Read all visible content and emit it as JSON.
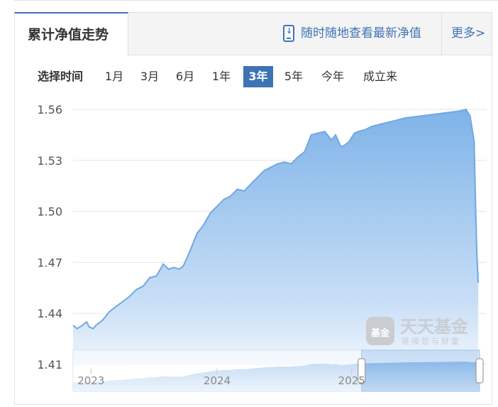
{
  "header": {
    "title": "累计净值走势",
    "promo_text": "随时随地查看最新净值",
    "more_label": "更多>"
  },
  "range_selector": {
    "label": "选择时间",
    "options": [
      "1月",
      "3月",
      "6月",
      "1年",
      "3年",
      "5年",
      "今年",
      "成立来"
    ],
    "active": "3年"
  },
  "watermark": {
    "name": "天天基金",
    "slogan": "链接您与财富",
    "badge": "基金"
  },
  "colors": {
    "accent": "#3e73b4",
    "line": "#6fa8e3",
    "fill": "#8ab9ea"
  },
  "chart_data": {
    "type": "area",
    "title": "",
    "xlabel": "",
    "ylabel": "",
    "ylim": [
      1.41,
      1.56
    ],
    "yticks": [
      "1.41",
      "1.44",
      "1.47",
      "1.50",
      "1.53",
      "1.56"
    ],
    "xticks": [
      {
        "x": 2023.0,
        "label": "2023"
      },
      {
        "x": 2024.0,
        "label": "2024"
      },
      {
        "x": 2025.0,
        "label": "2025"
      }
    ],
    "xlim": [
      2022.93,
      2025.95
    ],
    "grid": true,
    "series": [
      {
        "x": [
          2022.93,
          2022.96,
          2023.0,
          2023.03,
          2023.05,
          2023.08,
          2023.1,
          2023.15,
          2023.2,
          2023.25,
          2023.3,
          2023.35,
          2023.4,
          2023.45,
          2023.5,
          2023.55,
          2023.6,
          2023.64,
          2023.68,
          2023.72,
          2023.75,
          2023.8,
          2023.85,
          2023.9,
          2023.95,
          2024.0,
          2024.05,
          2024.1,
          2024.15,
          2024.2,
          2024.25,
          2024.3,
          2024.35,
          2024.4,
          2024.45,
          2024.5,
          2024.55,
          2024.6,
          2024.65,
          2024.7,
          2024.75,
          2024.8,
          2024.85,
          2024.88,
          2024.92,
          2024.95,
          2024.98,
          2025.02,
          2025.05,
          2025.1,
          2025.15,
          2025.2,
          2025.3,
          2025.4,
          2025.5,
          2025.6,
          2025.7,
          2025.8,
          2025.85,
          2025.88,
          2025.91,
          2025.92,
          2025.93,
          2025.94
        ],
        "values": [
          1.433,
          1.431,
          1.433,
          1.435,
          1.432,
          1.431,
          1.433,
          1.436,
          1.441,
          1.444,
          1.447,
          1.45,
          1.454,
          1.456,
          1.461,
          1.462,
          1.469,
          1.466,
          1.467,
          1.466,
          1.468,
          1.477,
          1.487,
          1.492,
          1.499,
          1.503,
          1.507,
          1.509,
          1.513,
          1.512,
          1.516,
          1.52,
          1.524,
          1.526,
          1.528,
          1.529,
          1.528,
          1.532,
          1.535,
          1.545,
          1.546,
          1.547,
          1.542,
          1.545,
          1.538,
          1.539,
          1.541,
          1.546,
          1.547,
          1.548,
          1.55,
          1.551,
          1.553,
          1.555,
          1.556,
          1.557,
          1.558,
          1.559,
          1.56,
          1.556,
          1.541,
          1.505,
          1.475,
          1.458
        ]
      }
    ],
    "navigator": {
      "x_start": 2025.0,
      "x_end": 2025.95
    }
  }
}
